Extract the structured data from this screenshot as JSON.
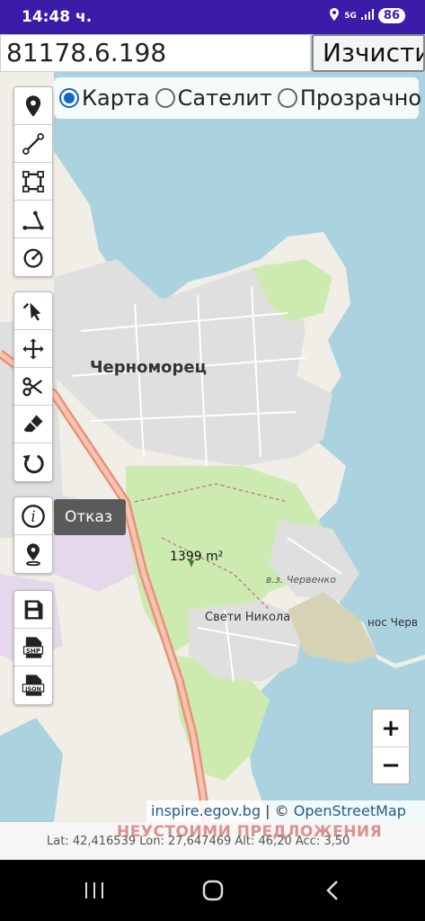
{
  "status_bar": {
    "time": "14:48 ч.",
    "network": "5G",
    "battery": "86",
    "icons": [
      "location-icon",
      "signal-icon",
      "battery-icon"
    ]
  },
  "top_bar": {
    "input_value": "81178.6.198",
    "clear_label": "Изчисти"
  },
  "layer_options": {
    "selected": "Карта",
    "options": [
      "Карта",
      "Сателит",
      "Прозрачно"
    ]
  },
  "toolbar": {
    "group1": [
      "marker-icon",
      "line-icon",
      "polygon-icon",
      "angle-icon",
      "circle-icon"
    ],
    "group2": [
      "select-pointer-icon",
      "move-icon",
      "scissors-icon",
      "eraser-icon",
      "undo-icon"
    ],
    "group3": [
      "info-icon",
      "pin-drop-icon"
    ],
    "group4": [
      "save-icon",
      "shp-file-icon",
      "json-file-icon"
    ]
  },
  "tooltip": {
    "text": "Отказ"
  },
  "map": {
    "city_label": "Черноморец",
    "area_label": "1399 m²",
    "locality_label": "в.з. Червенко",
    "village_label": "Свети Никола",
    "cape_label": "нос Черв"
  },
  "zoom": {
    "in": "+",
    "out": "−"
  },
  "attribution": {
    "source": "inspire.egov.bg",
    "separator": " | © ",
    "osm": "OpenStreetMap"
  },
  "watermark": "НЕУСТОИМИ ПРЕДЛОЖЕНИЯ",
  "position_readout": "Lat: 42,416539 Lon: 27,647469 Alt: 46,20 Acc: 3,50",
  "colors": {
    "status_bar": "#3a1ca8",
    "sea": "#aad3df",
    "land": "#f1eee7",
    "park": "#cdebb0",
    "residential": "#e0dfdf",
    "road_primary": "#e8927c"
  }
}
